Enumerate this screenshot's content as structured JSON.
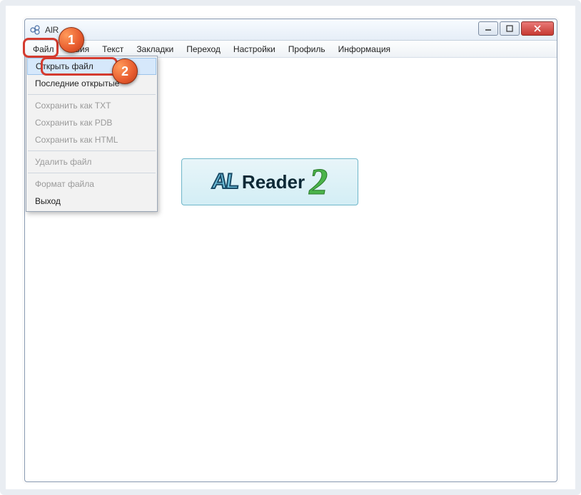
{
  "window": {
    "title": "AlR"
  },
  "menubar": {
    "items": [
      {
        "label": "Файл"
      },
      {
        "label": "…вия"
      },
      {
        "label": "Текст"
      },
      {
        "label": "Закладки"
      },
      {
        "label": "Переход"
      },
      {
        "label": "Настройки"
      },
      {
        "label": "Профиль"
      },
      {
        "label": "Информация"
      }
    ]
  },
  "dropdown": {
    "items": [
      {
        "label": "Открыть файл",
        "enabled": true,
        "highlight": true
      },
      {
        "label": "Последние открытые",
        "enabled": true
      },
      {
        "sep": true
      },
      {
        "label": "Сохранить как TXT",
        "enabled": false
      },
      {
        "label": "Сохранить как PDB",
        "enabled": false
      },
      {
        "label": "Сохранить как HTML",
        "enabled": false
      },
      {
        "sep": true
      },
      {
        "label": "Удалить файл",
        "enabled": false
      },
      {
        "sep": true
      },
      {
        "label": "Формат файла",
        "enabled": false
      },
      {
        "label": "Выход",
        "enabled": true
      }
    ]
  },
  "logo": {
    "al": "AL",
    "reader": "Reader",
    "two": "2"
  },
  "annotations": {
    "badge1": "1",
    "badge2": "2"
  }
}
